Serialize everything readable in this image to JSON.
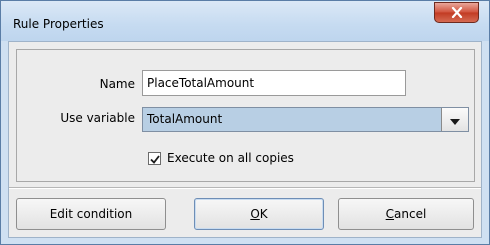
{
  "window": {
    "title": "Rule Properties"
  },
  "form": {
    "name_label": "Name",
    "name_value": "PlaceTotalAmount",
    "variable_label": "Use variable",
    "variable_value": "TotalAmount",
    "execute_label": "Execute on all copies",
    "execute_checked": true
  },
  "buttons": {
    "edit_condition": "Edit condition",
    "ok_mnemonic": "O",
    "ok_rest": "K",
    "cancel_mnemonic": "C",
    "cancel_rest": "ancel"
  },
  "icons": {
    "close": "close-icon",
    "dropdown": "chevron-down-icon",
    "check": "checkmark-icon"
  },
  "colors": {
    "titlebar": "#c6dbf1",
    "close_button": "#d0513b",
    "combo_selected": "#b8cfe4"
  }
}
